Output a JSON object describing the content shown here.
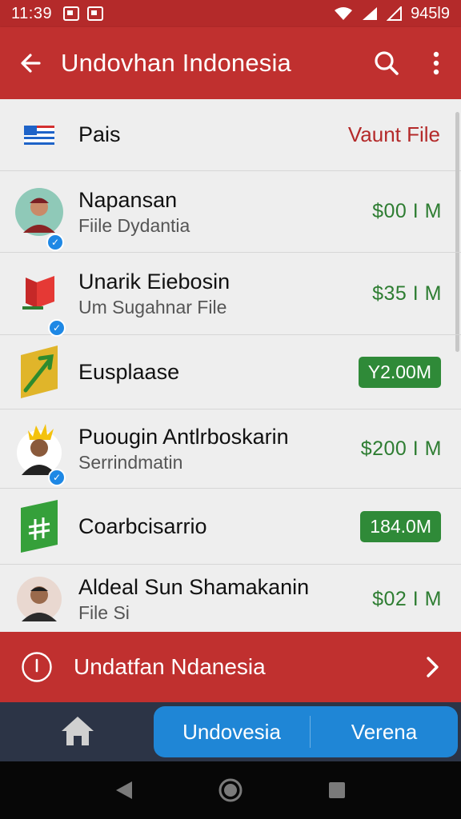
{
  "status_bar": {
    "time": "11:39",
    "right_text": "945l9"
  },
  "app_bar": {
    "title": "Undovhan Indonesia"
  },
  "list_header": {
    "label": "Pais",
    "link": "Vaunt File"
  },
  "rows": [
    {
      "name": "Napansan",
      "subtitle": "Fiile Dydantia",
      "amount": "$00 I M",
      "amount_style": "text"
    },
    {
      "name": "Unarik Eiebosin",
      "subtitle": "Um Sugahnar File",
      "amount": "$35 I M",
      "amount_style": "text"
    },
    {
      "name": "Eusplaase",
      "subtitle": "",
      "amount": "Y2.00M",
      "amount_style": "pill"
    },
    {
      "name": "Puougin Antlrboskarin",
      "subtitle": "Serrindmatin",
      "amount": "$200 I M",
      "amount_style": "text"
    },
    {
      "name": "Coarbcisarrio",
      "subtitle": "",
      "amount": "184.0M",
      "amount_style": "pill"
    },
    {
      "name": "Aldeal Sun Shamakanin",
      "subtitle": "File Si",
      "amount": "$02 I M",
      "amount_style": "text"
    }
  ],
  "banner": {
    "text": "Undatfan Ndanesia"
  },
  "bottom_nav": {
    "segment_left": "Undovesia",
    "segment_right": "Verena"
  },
  "icons": [
    "back-arrow-icon",
    "search-icon",
    "more-vert-icon",
    "flag-icon",
    "verified-badge-icon",
    "info-icon",
    "chevron-right-icon",
    "home-icon",
    "nav-back-icon",
    "nav-home-icon",
    "nav-recents-icon"
  ],
  "colors": {
    "primary": "#c0302f",
    "accent_green": "#2e7d32",
    "tab_blue": "#1f86d6",
    "nav_dark": "#2c3446"
  }
}
